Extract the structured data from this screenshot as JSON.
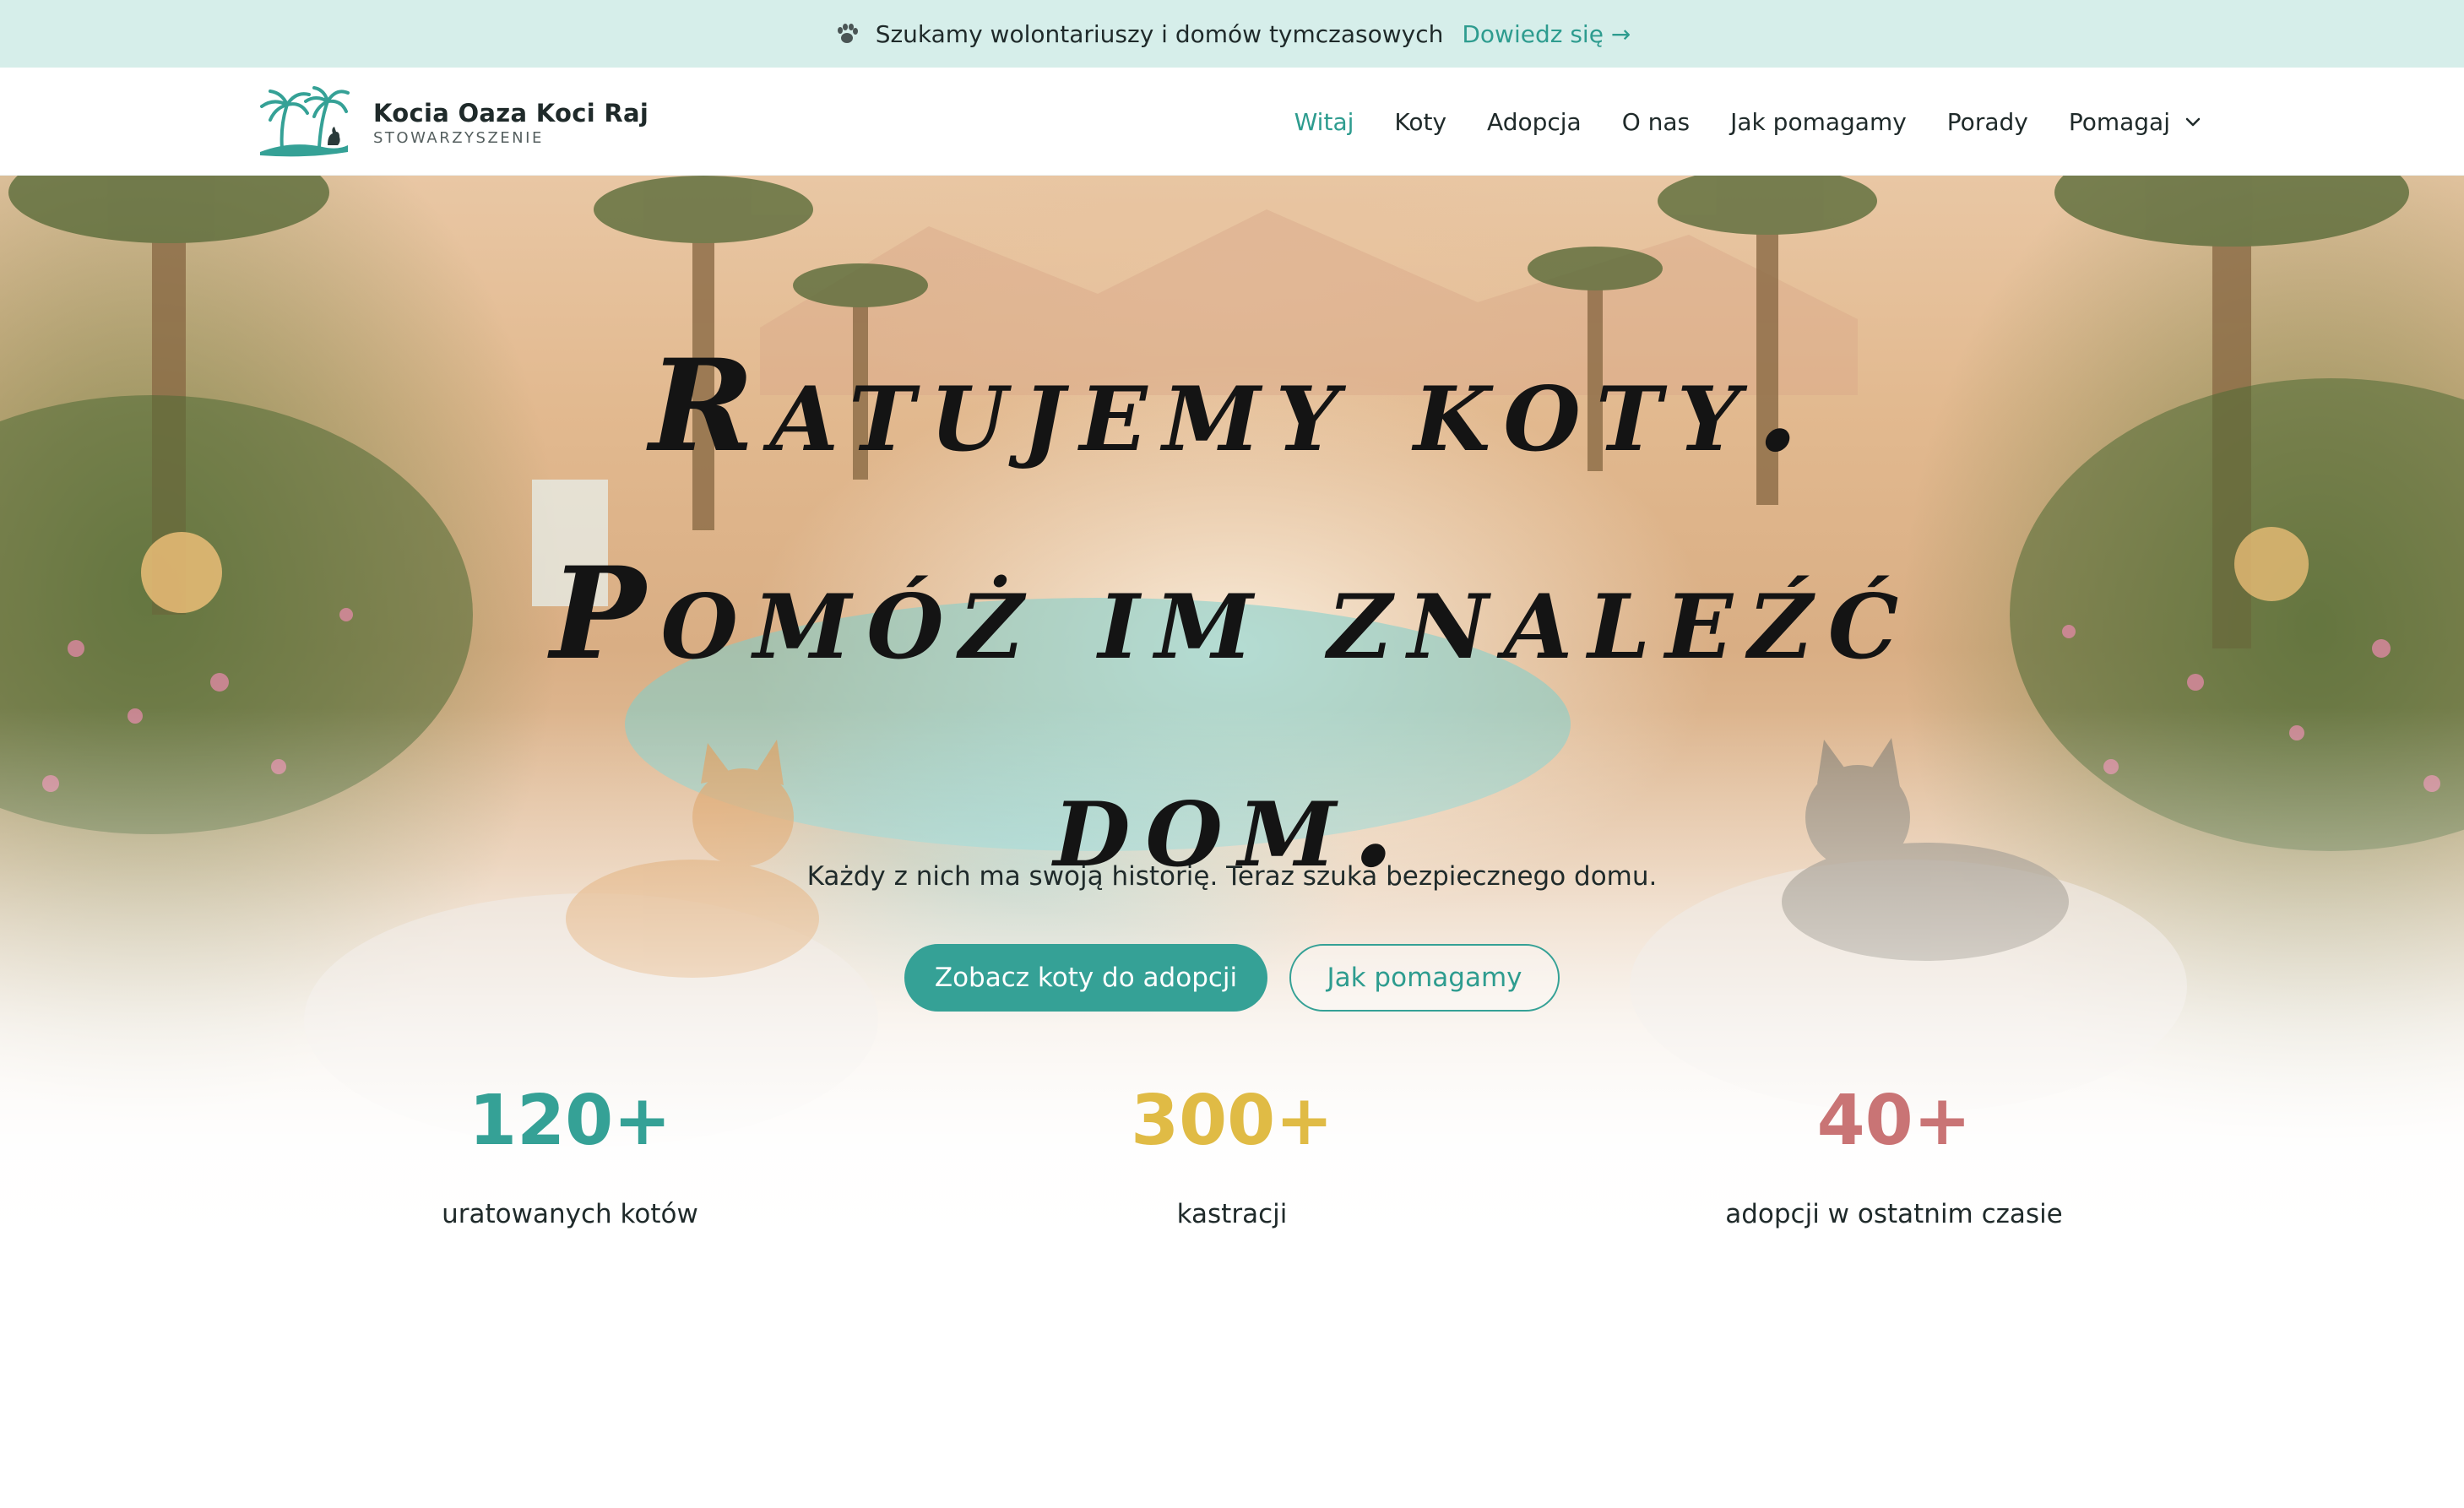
{
  "topbar": {
    "icon": "paw-icon",
    "message": "Szukamy wolontariuszy i domów tymczasowych",
    "link_label": "Dowiedz się →"
  },
  "brand": {
    "name": "Kocia Oaza Koci Raj",
    "subtitle": "STOWARZYSZENIE",
    "accent": "#35a196"
  },
  "nav": {
    "items": [
      {
        "label": "Witaj",
        "active": true
      },
      {
        "label": "Koty"
      },
      {
        "label": "Adopcja"
      },
      {
        "label": "O nas"
      },
      {
        "label": "Jak pomagamy"
      },
      {
        "label": "Porady"
      },
      {
        "label": "Pomagaj",
        "icon": "chevron-down-icon"
      }
    ]
  },
  "hero": {
    "title_lines": [
      "Ratujemy koty.",
      "Pomóż im znaleźć",
      "dom."
    ],
    "subtitle": "Każdy z nich ma swoją historię. Teraz szuka bezpiecznego domu.",
    "primary_button": "Zobacz koty do adopcji",
    "secondary_button": "Jak pomagamy"
  },
  "stats": [
    {
      "value": "120+",
      "label": "uratowanych kotów",
      "color": "#35a196"
    },
    {
      "value": "300+",
      "label": "kastracji",
      "color": "#e0bb45"
    },
    {
      "value": "40+",
      "label": "adopcji w ostatnim czasie",
      "color": "#c97475"
    }
  ]
}
